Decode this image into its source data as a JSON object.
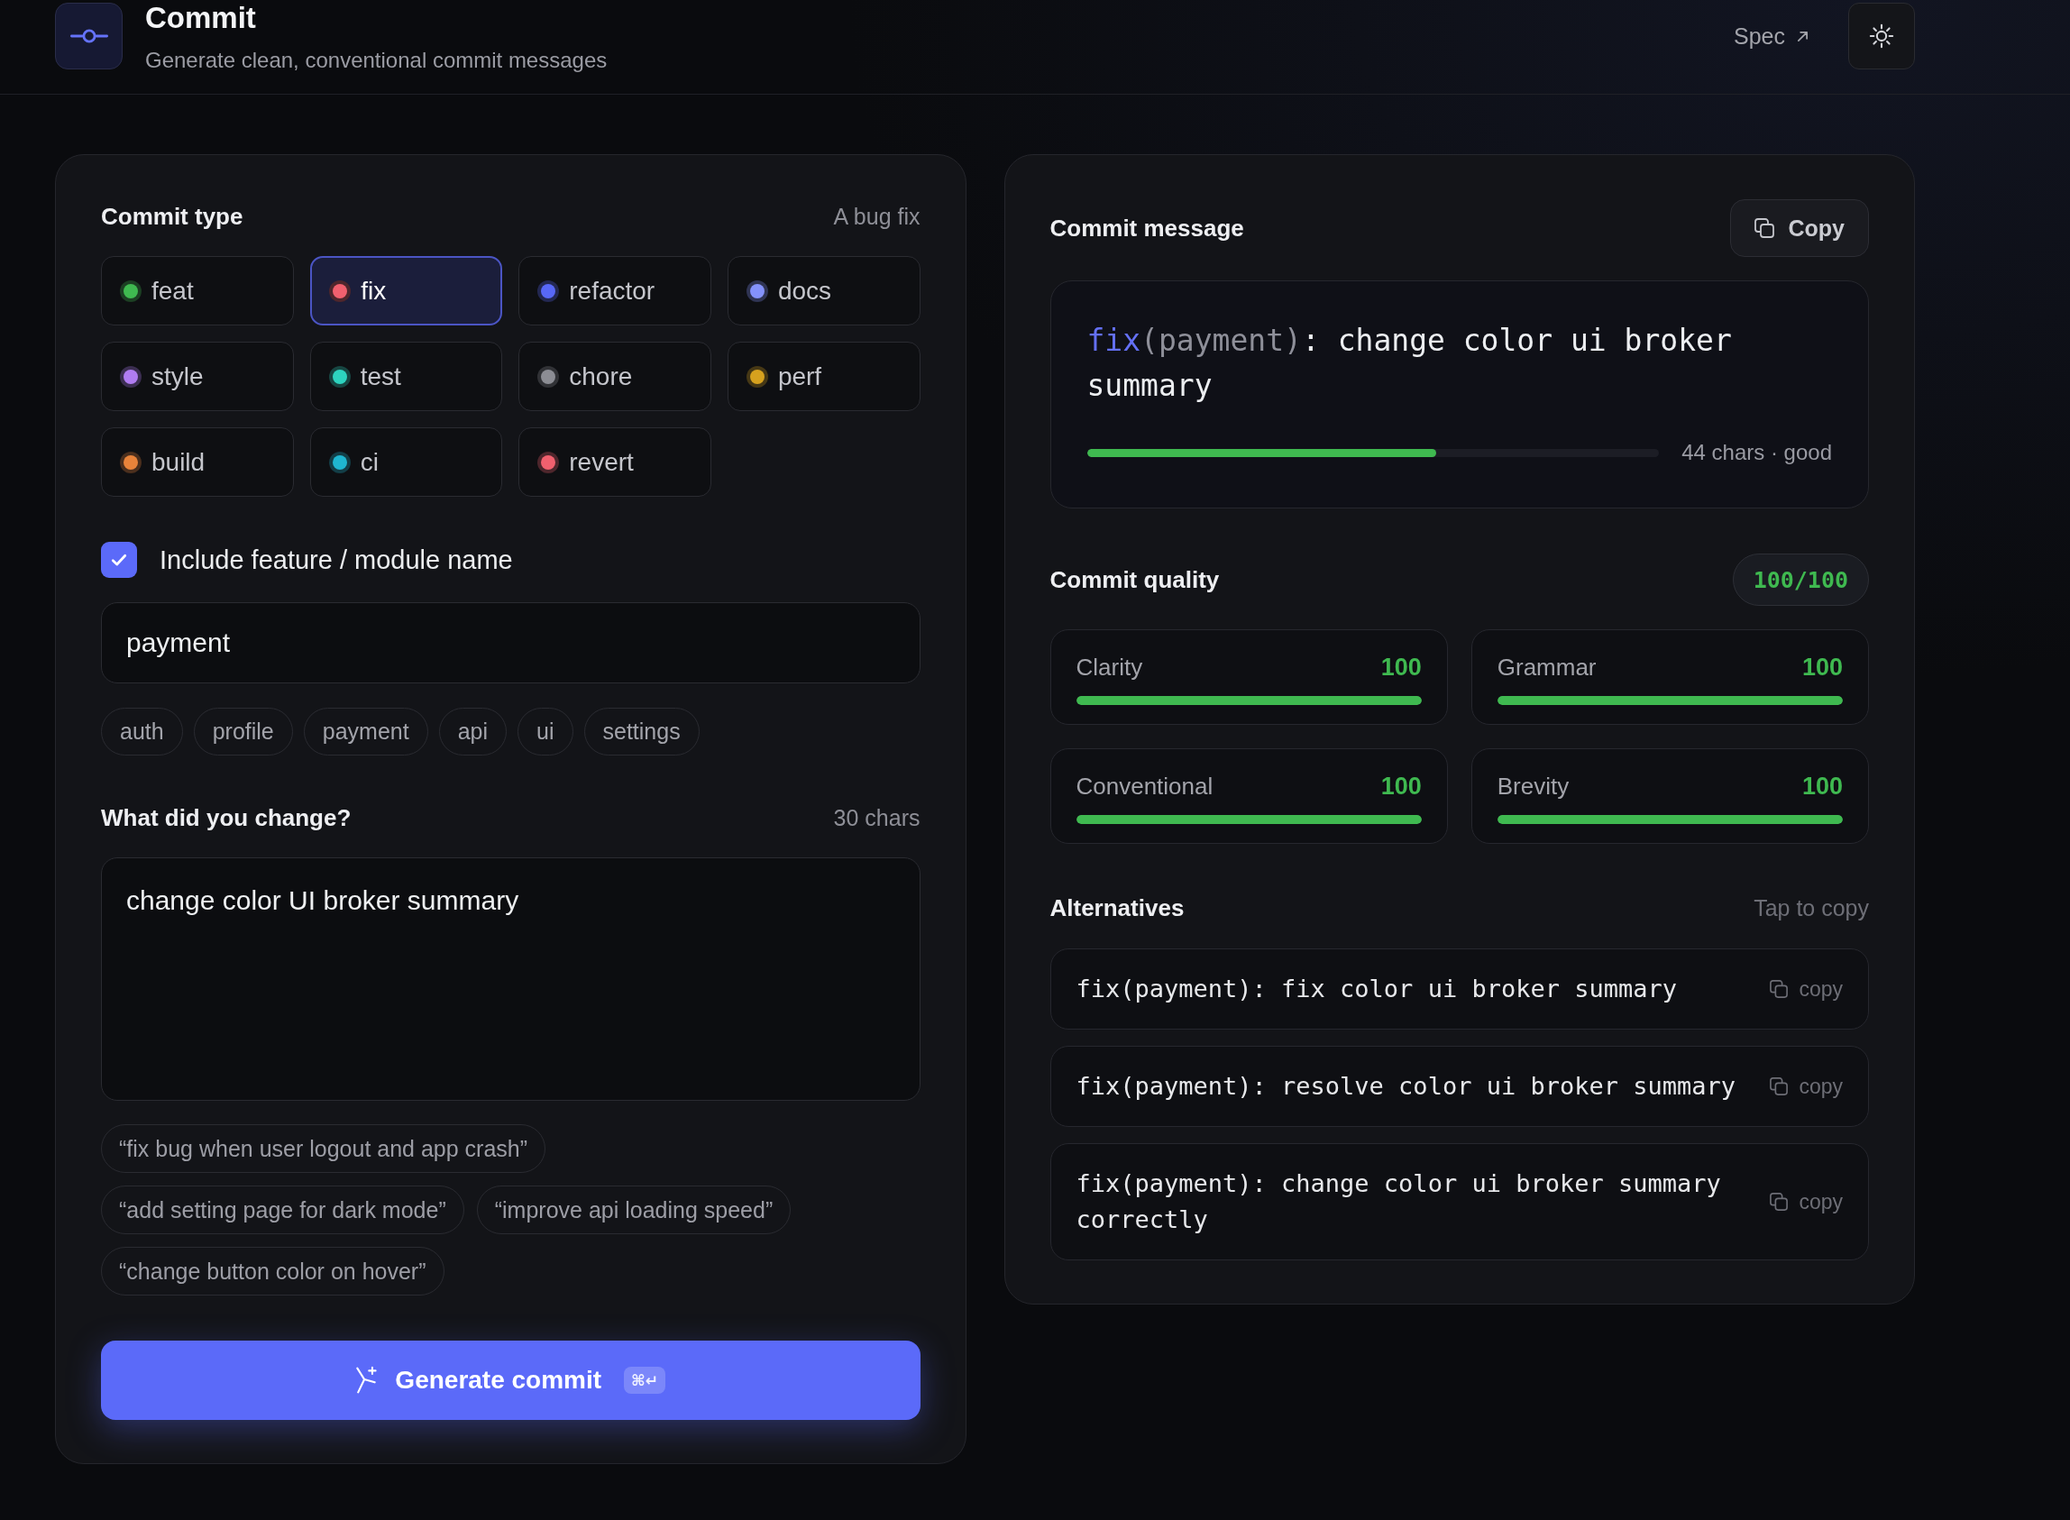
{
  "header": {
    "title": "Commit",
    "subtitle": "Generate clean, conventional commit messages",
    "spec_link": "Spec"
  },
  "commit_type": {
    "title": "Commit type",
    "description": "A bug fix",
    "options": [
      {
        "label": "feat",
        "color": "#3fb950",
        "selected": false
      },
      {
        "label": "fix",
        "color": "#f1606e",
        "selected": true
      },
      {
        "label": "refactor",
        "color": "#5868f7",
        "selected": false
      },
      {
        "label": "docs",
        "color": "#8492fb",
        "selected": false
      },
      {
        "label": "style",
        "color": "#b07cf2",
        "selected": false
      },
      {
        "label": "test",
        "color": "#2dd4bf",
        "selected": false
      },
      {
        "label": "chore",
        "color": "#8c8d94",
        "selected": false
      },
      {
        "label": "perf",
        "color": "#d6a11e",
        "selected": false
      },
      {
        "label": "build",
        "color": "#e8833a",
        "selected": false
      },
      {
        "label": "ci",
        "color": "#1fb6d0",
        "selected": false
      },
      {
        "label": "revert",
        "color": "#f1606e",
        "selected": false
      }
    ]
  },
  "module": {
    "label": "Include feature / module name",
    "checked": true,
    "value": "payment",
    "suggestions": [
      "auth",
      "profile",
      "payment",
      "api",
      "ui",
      "settings"
    ]
  },
  "change": {
    "title": "What did you change?",
    "count": "30 chars",
    "value": "change color UI broker summary",
    "examples": [
      "“fix bug when user logout and app crash”",
      "“add setting page for dark mode”",
      "“improve api loading speed”",
      "“change button color on hover”"
    ]
  },
  "generate_button": {
    "label": "Generate commit",
    "shortcut": "⌘↵"
  },
  "commit_message": {
    "title": "Commit message",
    "copy_button": "Copy",
    "prefix": "fix",
    "scope": "(payment)",
    "subject": ": change color ui broker summary",
    "length": {
      "level": 0.61,
      "reading": "44 chars · good"
    }
  },
  "commit_quality": {
    "title": "Commit quality",
    "total": "100/100",
    "metrics": [
      {
        "label": "Clarity",
        "score": "100",
        "level": 1
      },
      {
        "label": "Grammar",
        "score": "100",
        "level": 1
      },
      {
        "label": "Conventional",
        "score": "100",
        "level": 1
      },
      {
        "label": "Brevity",
        "score": "100",
        "level": 1
      }
    ]
  },
  "alternatives": {
    "title": "Alternatives",
    "hint": "Tap to copy",
    "items": [
      {
        "text": "fix(payment): fix color ui broker summary",
        "action": "copy"
      },
      {
        "text": "fix(payment): resolve color ui broker summary",
        "action": "copy"
      },
      {
        "text": "fix(payment): change color ui broker summary correctly",
        "action": "copy"
      }
    ]
  }
}
